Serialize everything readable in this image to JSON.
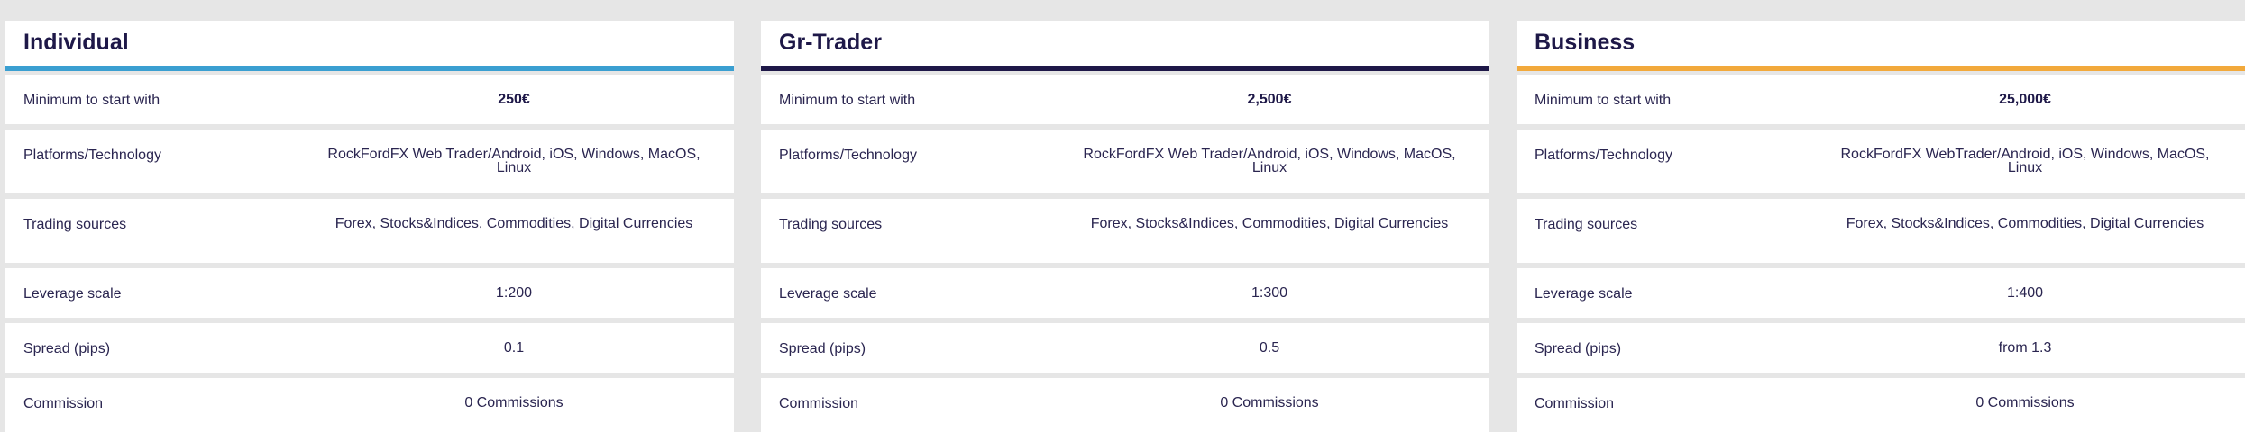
{
  "plans": [
    {
      "name": "Individual",
      "accent": "#3a9fd1",
      "rows": [
        {
          "label": "Minimum to start with",
          "value": "250€"
        },
        {
          "label": "Platforms/Technology",
          "value": "RockFordFX Web Trader/Android, iOS, Windows, MacOS, Linux"
        },
        {
          "label": "Trading sources",
          "value": "Forex, Stocks&Indices, Commodities, Digital Currencies"
        },
        {
          "label": "Leverage scale",
          "value": "1:200"
        },
        {
          "label": "Spread (pips)",
          "value": "0.1"
        },
        {
          "label": "Commission",
          "value": "0 Commissions"
        }
      ]
    },
    {
      "name": "Gr-Trader",
      "accent": "#1e1848",
      "rows": [
        {
          "label": "Minimum to start with",
          "value": "2,500€"
        },
        {
          "label": "Platforms/Technology",
          "value": "RockFordFX Web Trader/Android, iOS, Windows, MacOS, Linux"
        },
        {
          "label": "Trading sources",
          "value": "Forex, Stocks&Indices, Commodities, Digital Currencies"
        },
        {
          "label": "Leverage scale",
          "value": "1:300"
        },
        {
          "label": "Spread (pips)",
          "value": "0.5"
        },
        {
          "label": "Commission",
          "value": "0 Commissions"
        }
      ]
    },
    {
      "name": "Business",
      "accent": "#f2a93b",
      "rows": [
        {
          "label": "Minimum to start with",
          "value": "25,000€"
        },
        {
          "label": "Platforms/Technology",
          "value": "RockFordFX WebTrader/Android, iOS, Windows, MacOS, Linux"
        },
        {
          "label": "Trading sources",
          "value": "Forex, Stocks&Indices, Commodities, Digital Currencies"
        },
        {
          "label": "Leverage scale",
          "value": "1:400"
        },
        {
          "label": "Spread (pips)",
          "value": "from 1.3"
        },
        {
          "label": "Commission",
          "value": "0 Commissions"
        }
      ]
    }
  ]
}
